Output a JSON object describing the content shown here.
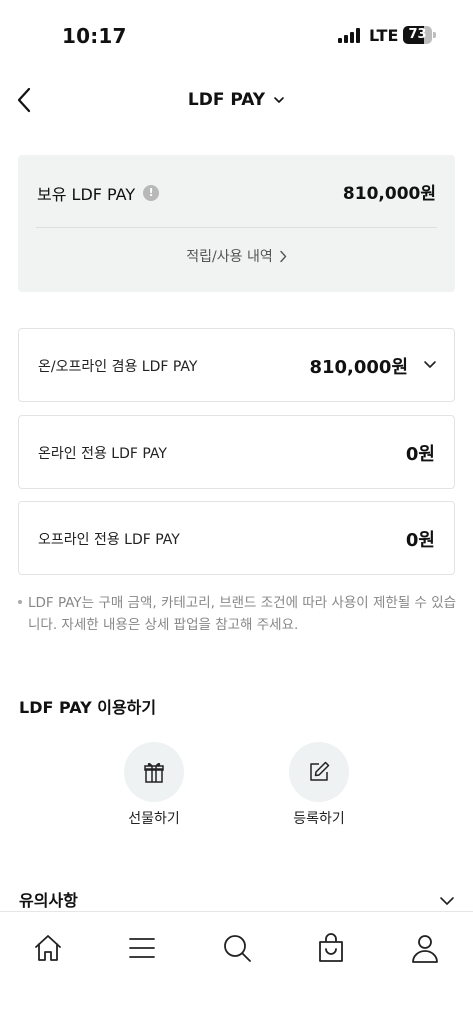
{
  "status_bar": {
    "time": "10:17",
    "network": "LTE",
    "battery": "73",
    "battery_level": 0.73
  },
  "header": {
    "title": "LDF PAY",
    "back_icon": "chevron-left-icon",
    "title_dropdown_icon": "chevron-down-icon"
  },
  "summary": {
    "label": "보유 LDF PAY",
    "info_icon": "!",
    "amount": "810,000원",
    "history_link": "적립/사용 내역"
  },
  "balances": [
    {
      "label": "온/오프라인 겸용 LDF PAY",
      "amount": "810,000원",
      "expandable": true
    },
    {
      "label": "온라인 전용 LDF PAY",
      "amount": "0원",
      "expandable": false
    },
    {
      "label": "오프라인 전용 LDF PAY",
      "amount": "0원",
      "expandable": false
    }
  ],
  "notice": "LDF PAY는 구매 금액, 카테고리, 브랜드 조건에 따라 사용이 제한될 수 있습니다. 자세한 내용은 상세 팝업을 참고해 주세요.",
  "usage": {
    "title": "LDF PAY 이용하기",
    "actions": [
      {
        "label": "선물하기",
        "icon": "gift-icon"
      },
      {
        "label": "등록하기",
        "icon": "edit-icon"
      }
    ]
  },
  "caution": {
    "title": "유의사항"
  },
  "tabbar": {
    "items": [
      {
        "icon": "home-icon"
      },
      {
        "icon": "menu-icon"
      },
      {
        "icon": "search-icon"
      },
      {
        "icon": "shopping-bag-icon"
      },
      {
        "icon": "user-icon"
      }
    ]
  }
}
